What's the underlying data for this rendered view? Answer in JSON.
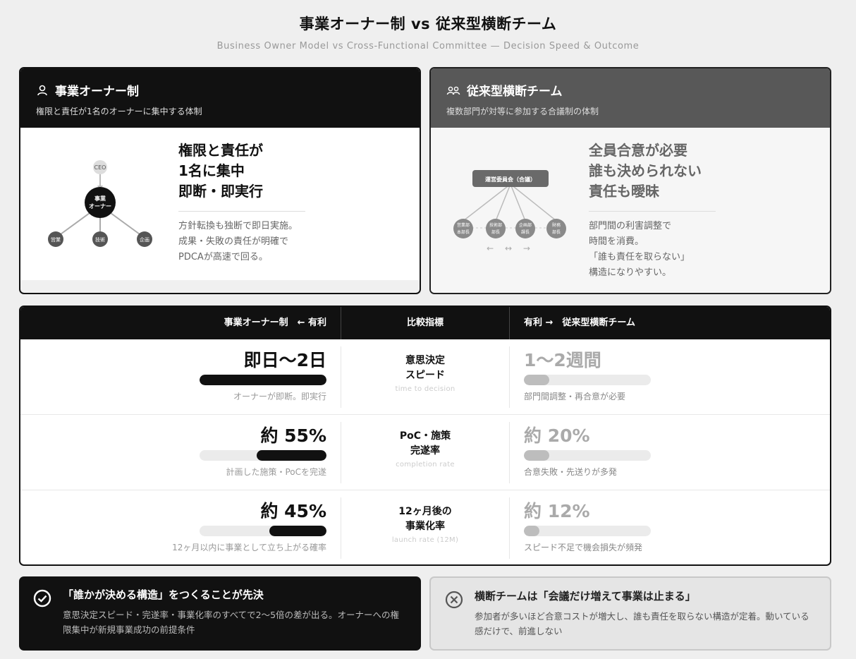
{
  "title": "事業オーナー制 vs 従来型横断チーム",
  "subtitle": "Business Owner Model vs Cross-Functional Committee — Decision Speed & Outcome",
  "owner_card": {
    "title": "事業オーナー制",
    "desc": "権限と責任が1名のオーナーに集中する体制",
    "headline": "権限と責任が\n1名に集中\n即断・即実行",
    "body": "方針転換も独断で即日実施。\n成果・失敗の責任が明確で\nPDCAが高速で回る。",
    "diagram": {
      "top": "CEO",
      "center_line1": "事業",
      "center_line2": "オーナー",
      "nodes": [
        "営業",
        "技術",
        "企画"
      ]
    }
  },
  "committee_card": {
    "title": "従来型横断チーム",
    "desc": "複数部門が対等に参加する合議制の体制",
    "headline": "全員合意が必要\n誰も決められない\n責任も曖昧",
    "body": "部門間の利害調整で\n時間を消費。\n「誰も責任を取らない」\n構造になりやすい。",
    "diagram": {
      "box": "運営委員会（合議）",
      "nodes": [
        {
          "line1": "営業部",
          "line2": "本部長"
        },
        {
          "line1": "技術部",
          "line2": "部長"
        },
        {
          "line1": "企画部",
          "line2": "課長"
        },
        {
          "line1": "財務",
          "line2": "部長"
        }
      ],
      "arrows": "← ↔ →"
    }
  },
  "table": {
    "head_left": "事業オーナー制　← 有利",
    "head_mid": "比較指標",
    "head_right": "有利 →　従来型横断チーム",
    "rows": [
      {
        "left_value": "即日〜2日",
        "left_fill": 1.0,
        "left_note": "オーナーが即断。即実行",
        "metric": "意思決定\nスピード",
        "metric_sub": "time to decision",
        "right_value": "1〜2週間",
        "right_fill": 0.2,
        "right_note": "部門間調整・再合意が必要"
      },
      {
        "left_value": "約 55%",
        "left_fill": 0.55,
        "left_note": "計画した施策・PoCを完遂",
        "metric": "PoC・施策\n完遂率",
        "metric_sub": "completion rate",
        "right_value": "約 20%",
        "right_fill": 0.2,
        "right_note": "合意失敗・先送りが多発"
      },
      {
        "left_value": "約 45%",
        "left_fill": 0.45,
        "left_note": "12ヶ月以内に事業として立ち上がる確率",
        "metric": "12ヶ月後の\n事業化率",
        "metric_sub": "launch rate (12M)",
        "right_value": "約 12%",
        "right_fill": 0.12,
        "right_note": "スピード不足で機会損失が頻発"
      }
    ]
  },
  "footer_left": {
    "title": "「誰かが決める構造」をつくることが先決",
    "desc": "意思決定スピード・完遂率・事業化率のすべてで2〜5倍の差が出る。オーナーへの権限集中が新規事業成功の前提条件"
  },
  "footer_right": {
    "title": "横断チームは「会議だけ増えて事業は止まる」",
    "desc": "参加者が多いほど合意コストが増大し、誰も責任を取らない構造が定着。動いている感だけで、前進しない"
  }
}
